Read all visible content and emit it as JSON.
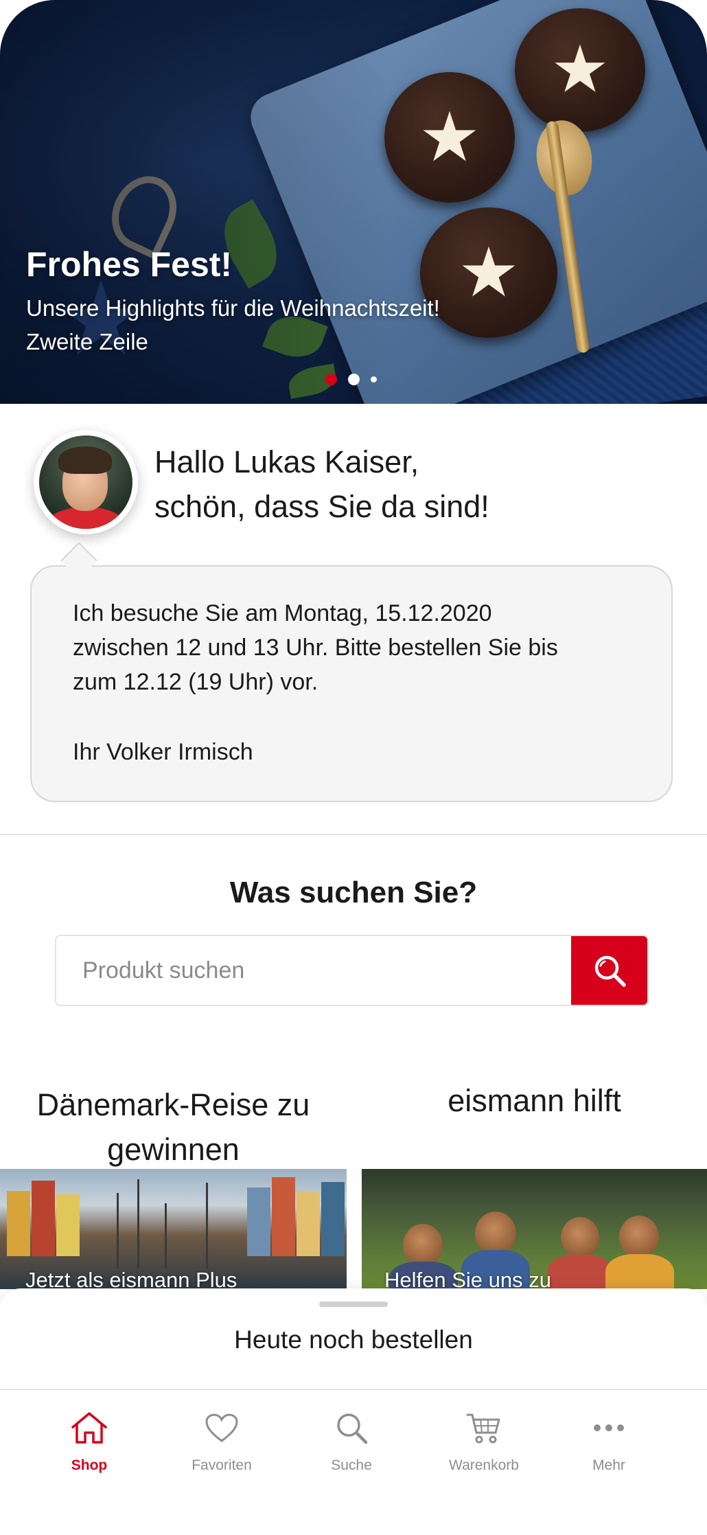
{
  "hero": {
    "title": "Frohes Fest!",
    "subtitle_line1": "Unsere Highlights für die Weihnachtszeit!",
    "subtitle_line2": "Zweite Zeile",
    "carousel": {
      "count": 3,
      "active": 1
    }
  },
  "greeting": {
    "line1": "Hallo Lukas Kaiser,",
    "line2": "schön, dass Sie da sind!"
  },
  "message": {
    "line1": "Ich besuche Sie am Montag, 15.12.2020",
    "line2": "zwischen 12 und 13 Uhr. Bitte bestellen Sie bis",
    "line3": "zum 12.12 (19 Uhr) vor.",
    "signature": "Ihr Volker Irmisch"
  },
  "search": {
    "title": "Was suchen Sie?",
    "placeholder": "Produkt suchen",
    "value": ""
  },
  "promos": [
    {
      "title_line1": "Dänemark-Reise zu",
      "title_line2": "gewinnen",
      "caption": "Jetzt als eismann Plus"
    },
    {
      "title_line1": "eismann hilft",
      "caption": "Helfen Sie uns zu"
    }
  ],
  "sheet": {
    "title": "Heute noch bestellen"
  },
  "tabs": [
    {
      "label": "Shop",
      "icon": "home-icon",
      "active": true
    },
    {
      "label": "Favoriten",
      "icon": "heart-icon",
      "active": false
    },
    {
      "label": "Suche",
      "icon": "search-icon",
      "active": false
    },
    {
      "label": "Warenkorb",
      "icon": "cart-icon",
      "active": false
    },
    {
      "label": "Mehr",
      "icon": "more-icon",
      "active": false
    }
  ],
  "colors": {
    "accent": "#d7001b",
    "text": "#1a1a1a",
    "muted": "#8e8e8e",
    "bubble_bg": "#f5f5f5"
  }
}
